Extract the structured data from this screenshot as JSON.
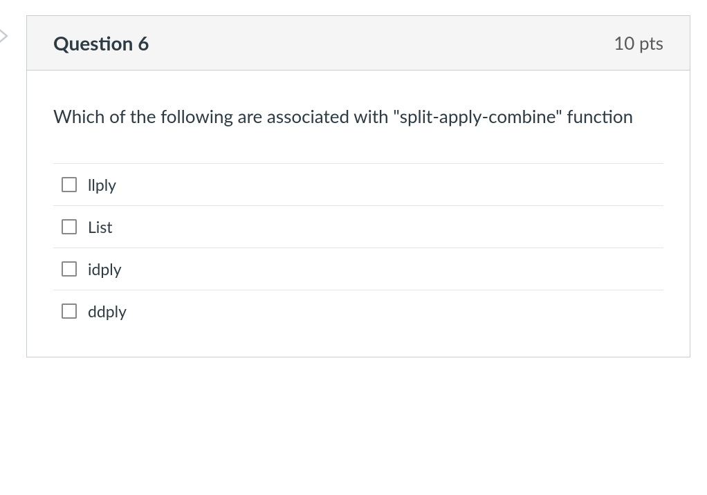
{
  "header": {
    "title": "Question 6",
    "points": "10 pts"
  },
  "question_text": "Which of the following are associated with \"split-apply-combine\" function",
  "options": [
    {
      "label": "llply"
    },
    {
      "label": "List"
    },
    {
      "label": "idply"
    },
    {
      "label": "ddply"
    }
  ]
}
